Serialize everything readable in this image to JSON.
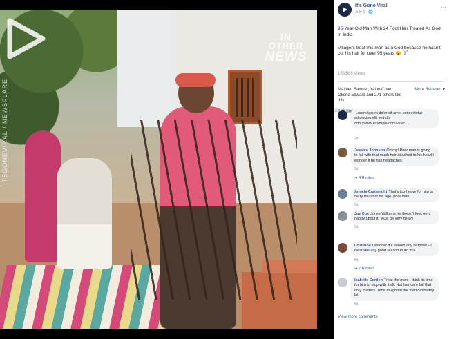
{
  "video": {
    "side_credit": "ITSGONEVIRAL / NEWSFLARE",
    "watermark": {
      "line1": "IN",
      "line2": "OTHER",
      "line3": "NEWS"
    }
  },
  "post": {
    "page_name": "It's Gone Viral",
    "date": "July 5",
    "title": "95-Year-Old Man With 24 Foot Hair Treated As God In India",
    "text": "Villagers treat this man as a God because he hasn't cut his hair for over 95 years 😮 ✂️",
    "views": "155,586 Views",
    "likes": "Mathieu Samuel, Yalon Chan, Okeno Edward and 271 others like this.",
    "sort_label": "More Relevant ▾",
    "shares": "386 Shares",
    "comments_count": "561 Comments",
    "view_more": "View more comments"
  },
  "comments": [
    {
      "name": "",
      "text": "Lorem ipsum dolor sit amet consectetur adipiscing elit sed do http://www.example.com/video",
      "meta": "2d",
      "replies": "",
      "avatar_color": "#1c2b4a"
    },
    {
      "name": "Jessica Johnson",
      "text": "Oh my! Poor man is going to fall with that much hair attached to his head I wonder if he has headaches",
      "meta": "5d",
      "replies": "↪ 4 Replies",
      "avatar_color": "#7a5a3c"
    },
    {
      "name": "Angela Cartwright",
      "text": "That's too heavy for him to carry round at his age, poor man",
      "meta": "5d",
      "replies": "",
      "avatar_color": "#6b7f95"
    },
    {
      "name": "Jay Cox",
      "text": "Jones Williams he doesn't look very happy about it. Must be very heavy",
      "meta": "5d",
      "replies": "",
      "avatar_color": "#8a8f96"
    },
    {
      "name": "Christine",
      "text": "I wonder if it served any purpose - I can't see any good reason to do this",
      "meta": "5d",
      "replies": "↪ 7 Replies",
      "avatar_color": "#7c4d3a"
    },
    {
      "name": "Isabelle Corden",
      "text": "Treat the man. I think its time for him to stop with it all. Not hair care fail that only matters. Time to lighten the load old buddy lol",
      "meta": "5d",
      "replies": "",
      "avatar_color": "#c9cdd3"
    }
  ]
}
